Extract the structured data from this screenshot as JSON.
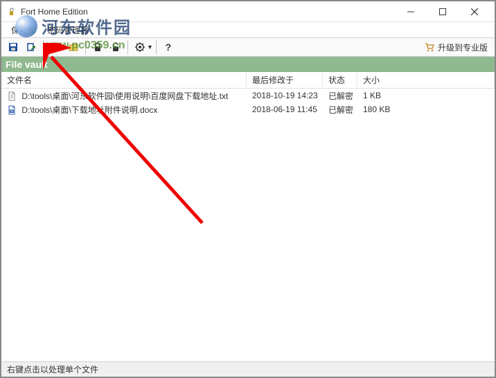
{
  "window": {
    "title": "Fort Home Edition"
  },
  "menubar": {
    "items": [
      "保险库",
      "密码管理器"
    ]
  },
  "toolbar": {
    "upgrade_label": "升级到专业版"
  },
  "watermark": {
    "text": "河东软件园",
    "url": "www.pc0359.cn"
  },
  "section": {
    "title": "File vault"
  },
  "table": {
    "columns": [
      "文件名",
      "最后修改于",
      "状态",
      "大小"
    ],
    "rows": [
      {
        "name": "D:\\tools\\桌面\\河东软件园\\使用说明\\百度网盘下载地址.txt",
        "date": "2018-10-19 14:23",
        "status": "已解密",
        "size": "1 KB"
      },
      {
        "name": "D:\\tools\\桌面\\下载地址附件说明.docx",
        "date": "2018-06-19 11:45",
        "status": "已解密",
        "size": "180 KB"
      }
    ]
  },
  "statusbar": {
    "text": "右键点击以处理单个文件"
  }
}
